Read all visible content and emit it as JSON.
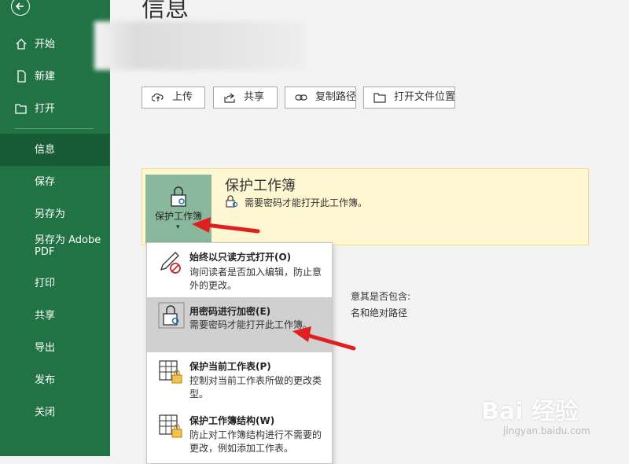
{
  "sidebar": {
    "top_items": [
      {
        "label": "开始",
        "icon": "home-icon"
      },
      {
        "label": "新建",
        "icon": "new-document-icon"
      },
      {
        "label": "打开",
        "icon": "folder-open-icon"
      }
    ],
    "bottom_items": [
      {
        "label": "信息",
        "active": true
      },
      {
        "label": "保存"
      },
      {
        "label": "另存为"
      },
      {
        "label": "另存为 Adobe PDF"
      },
      {
        "label": "打印"
      },
      {
        "label": "共享"
      },
      {
        "label": "导出"
      },
      {
        "label": "发布"
      },
      {
        "label": "关闭"
      }
    ]
  },
  "page": {
    "title": "信息"
  },
  "toolbar": {
    "upload": "上传",
    "share": "共享",
    "copy_path": "复制路径",
    "open_location": "打开文件位置"
  },
  "protect": {
    "button_label": "保护工作簿",
    "title": "保护工作簿",
    "description": "需要密码才能打开此工作簿。"
  },
  "background_text": {
    "line1": "意其是否包含:",
    "line2": "名和绝对路径"
  },
  "menu": {
    "items": [
      {
        "title": "始终以只读方式打开(O)",
        "desc": "询问读者是否加入编辑，防止意外的更改。"
      },
      {
        "title": "用密码进行加密(E)",
        "desc": "需要密码才能打开此工作簿。",
        "highlighted": true
      },
      {
        "title": "保护当前工作表(P)",
        "desc": "控制对当前工作表所做的更改类型。"
      },
      {
        "title": "保护工作簿结构(W)",
        "desc": "防止对工作簿结构进行不需要的更改，例如添加工作表。"
      }
    ]
  },
  "watermark": {
    "brand": "Bai 经验",
    "url": "jingyan.baidu.com"
  },
  "colors": {
    "sidebar": "#217346",
    "sidebar_active": "#185c37",
    "protect_panel": "#fff7d1",
    "protect_button": "#89b89c",
    "arrow": "#e02020"
  }
}
